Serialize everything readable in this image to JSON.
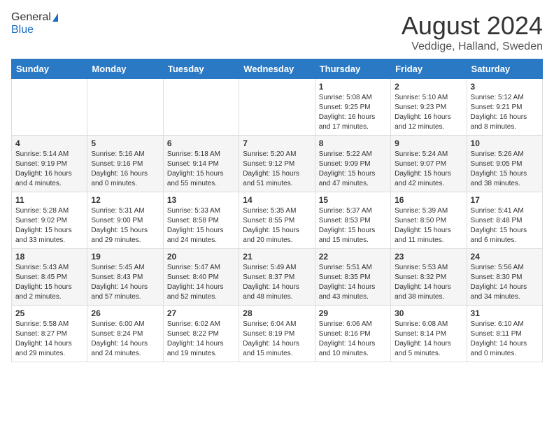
{
  "header": {
    "logo_general": "General",
    "logo_blue": "Blue",
    "main_title": "August 2024",
    "subtitle": "Veddige, Halland, Sweden"
  },
  "weekdays": [
    "Sunday",
    "Monday",
    "Tuesday",
    "Wednesday",
    "Thursday",
    "Friday",
    "Saturday"
  ],
  "weeks": [
    [
      {
        "day": "",
        "info": ""
      },
      {
        "day": "",
        "info": ""
      },
      {
        "day": "",
        "info": ""
      },
      {
        "day": "",
        "info": ""
      },
      {
        "day": "1",
        "info": "Sunrise: 5:08 AM\nSunset: 9:25 PM\nDaylight: 16 hours\nand 17 minutes."
      },
      {
        "day": "2",
        "info": "Sunrise: 5:10 AM\nSunset: 9:23 PM\nDaylight: 16 hours\nand 12 minutes."
      },
      {
        "day": "3",
        "info": "Sunrise: 5:12 AM\nSunset: 9:21 PM\nDaylight: 16 hours\nand 8 minutes."
      }
    ],
    [
      {
        "day": "4",
        "info": "Sunrise: 5:14 AM\nSunset: 9:19 PM\nDaylight: 16 hours\nand 4 minutes."
      },
      {
        "day": "5",
        "info": "Sunrise: 5:16 AM\nSunset: 9:16 PM\nDaylight: 16 hours\nand 0 minutes."
      },
      {
        "day": "6",
        "info": "Sunrise: 5:18 AM\nSunset: 9:14 PM\nDaylight: 15 hours\nand 55 minutes."
      },
      {
        "day": "7",
        "info": "Sunrise: 5:20 AM\nSunset: 9:12 PM\nDaylight: 15 hours\nand 51 minutes."
      },
      {
        "day": "8",
        "info": "Sunrise: 5:22 AM\nSunset: 9:09 PM\nDaylight: 15 hours\nand 47 minutes."
      },
      {
        "day": "9",
        "info": "Sunrise: 5:24 AM\nSunset: 9:07 PM\nDaylight: 15 hours\nand 42 minutes."
      },
      {
        "day": "10",
        "info": "Sunrise: 5:26 AM\nSunset: 9:05 PM\nDaylight: 15 hours\nand 38 minutes."
      }
    ],
    [
      {
        "day": "11",
        "info": "Sunrise: 5:28 AM\nSunset: 9:02 PM\nDaylight: 15 hours\nand 33 minutes."
      },
      {
        "day": "12",
        "info": "Sunrise: 5:31 AM\nSunset: 9:00 PM\nDaylight: 15 hours\nand 29 minutes."
      },
      {
        "day": "13",
        "info": "Sunrise: 5:33 AM\nSunset: 8:58 PM\nDaylight: 15 hours\nand 24 minutes."
      },
      {
        "day": "14",
        "info": "Sunrise: 5:35 AM\nSunset: 8:55 PM\nDaylight: 15 hours\nand 20 minutes."
      },
      {
        "day": "15",
        "info": "Sunrise: 5:37 AM\nSunset: 8:53 PM\nDaylight: 15 hours\nand 15 minutes."
      },
      {
        "day": "16",
        "info": "Sunrise: 5:39 AM\nSunset: 8:50 PM\nDaylight: 15 hours\nand 11 minutes."
      },
      {
        "day": "17",
        "info": "Sunrise: 5:41 AM\nSunset: 8:48 PM\nDaylight: 15 hours\nand 6 minutes."
      }
    ],
    [
      {
        "day": "18",
        "info": "Sunrise: 5:43 AM\nSunset: 8:45 PM\nDaylight: 15 hours\nand 2 minutes."
      },
      {
        "day": "19",
        "info": "Sunrise: 5:45 AM\nSunset: 8:43 PM\nDaylight: 14 hours\nand 57 minutes."
      },
      {
        "day": "20",
        "info": "Sunrise: 5:47 AM\nSunset: 8:40 PM\nDaylight: 14 hours\nand 52 minutes."
      },
      {
        "day": "21",
        "info": "Sunrise: 5:49 AM\nSunset: 8:37 PM\nDaylight: 14 hours\nand 48 minutes."
      },
      {
        "day": "22",
        "info": "Sunrise: 5:51 AM\nSunset: 8:35 PM\nDaylight: 14 hours\nand 43 minutes."
      },
      {
        "day": "23",
        "info": "Sunrise: 5:53 AM\nSunset: 8:32 PM\nDaylight: 14 hours\nand 38 minutes."
      },
      {
        "day": "24",
        "info": "Sunrise: 5:56 AM\nSunset: 8:30 PM\nDaylight: 14 hours\nand 34 minutes."
      }
    ],
    [
      {
        "day": "25",
        "info": "Sunrise: 5:58 AM\nSunset: 8:27 PM\nDaylight: 14 hours\nand 29 minutes."
      },
      {
        "day": "26",
        "info": "Sunrise: 6:00 AM\nSunset: 8:24 PM\nDaylight: 14 hours\nand 24 minutes."
      },
      {
        "day": "27",
        "info": "Sunrise: 6:02 AM\nSunset: 8:22 PM\nDaylight: 14 hours\nand 19 minutes."
      },
      {
        "day": "28",
        "info": "Sunrise: 6:04 AM\nSunset: 8:19 PM\nDaylight: 14 hours\nand 15 minutes."
      },
      {
        "day": "29",
        "info": "Sunrise: 6:06 AM\nSunset: 8:16 PM\nDaylight: 14 hours\nand 10 minutes."
      },
      {
        "day": "30",
        "info": "Sunrise: 6:08 AM\nSunset: 8:14 PM\nDaylight: 14 hours\nand 5 minutes."
      },
      {
        "day": "31",
        "info": "Sunrise: 6:10 AM\nSunset: 8:11 PM\nDaylight: 14 hours\nand 0 minutes."
      }
    ]
  ]
}
